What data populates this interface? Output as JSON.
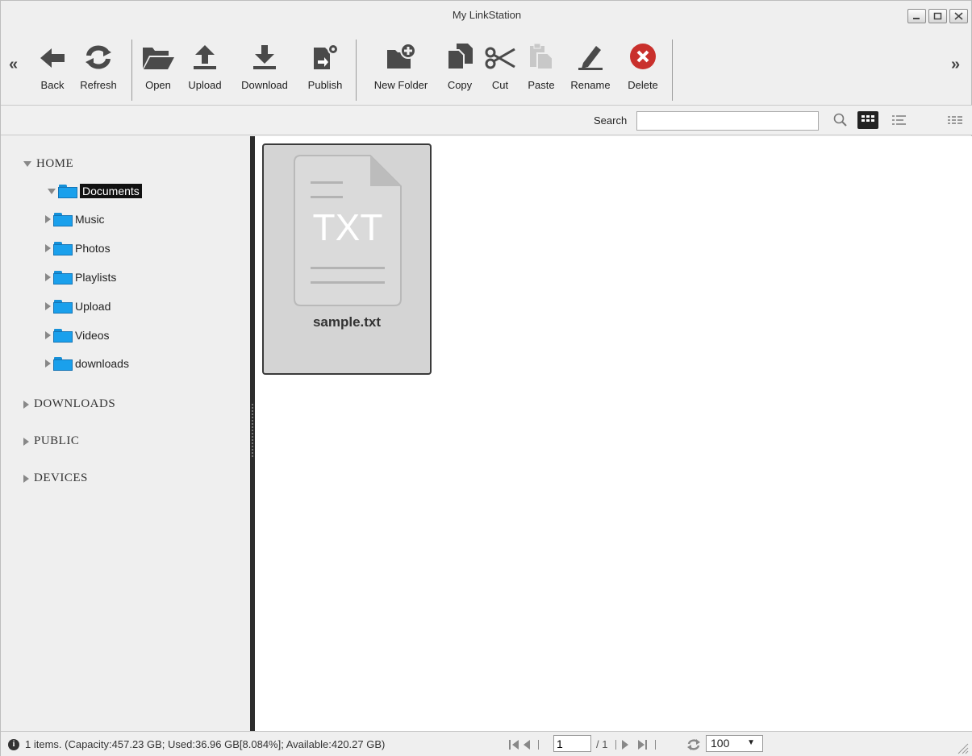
{
  "window": {
    "title": "My LinkStation"
  },
  "toolbar": {
    "buttons": [
      {
        "label": "Back",
        "icon": "back-arrow-icon"
      },
      {
        "label": "Refresh",
        "icon": "refresh-icon"
      },
      {
        "label": "Open",
        "icon": "open-folder-icon"
      },
      {
        "label": "Upload",
        "icon": "upload-icon"
      },
      {
        "label": "Download",
        "icon": "download-icon"
      },
      {
        "label": "Publish",
        "icon": "publish-icon"
      },
      {
        "label": "New Folder",
        "icon": "new-folder-icon"
      },
      {
        "label": "Copy",
        "icon": "copy-icon"
      },
      {
        "label": "Cut",
        "icon": "scissors-icon"
      },
      {
        "label": "Paste",
        "icon": "paste-icon"
      },
      {
        "label": "Rename",
        "icon": "pencil-icon"
      },
      {
        "label": "Delete",
        "icon": "delete-icon"
      }
    ],
    "scroll_left": "«",
    "scroll_right": "»"
  },
  "search": {
    "label": "Search",
    "value": ""
  },
  "sidebar": {
    "roots": [
      {
        "label": "HOME",
        "expanded": true
      },
      {
        "label": "DOWNLOADS",
        "expanded": false
      },
      {
        "label": "PUBLIC",
        "expanded": false
      },
      {
        "label": "DEVICES",
        "expanded": false
      }
    ],
    "home_items": [
      {
        "label": "Documents",
        "expanded": true,
        "selected": true
      },
      {
        "label": "Music"
      },
      {
        "label": "Photos"
      },
      {
        "label": "Playlists"
      },
      {
        "label": "Upload"
      },
      {
        "label": "Videos"
      },
      {
        "label": "downloads"
      }
    ]
  },
  "files": [
    {
      "name": "sample.txt",
      "type_label": "TXT"
    }
  ],
  "status": {
    "text": "1 items. (Capacity:457.23 GB; Used:36.96 GB[8.084%]; Available:420.27 GB)",
    "page": "1",
    "page_total": "/ 1",
    "per_page": "100"
  },
  "colors": {
    "folder": "#1aa0ec",
    "delete": "#c9302c",
    "tile_bg": "#d4d4d4"
  }
}
